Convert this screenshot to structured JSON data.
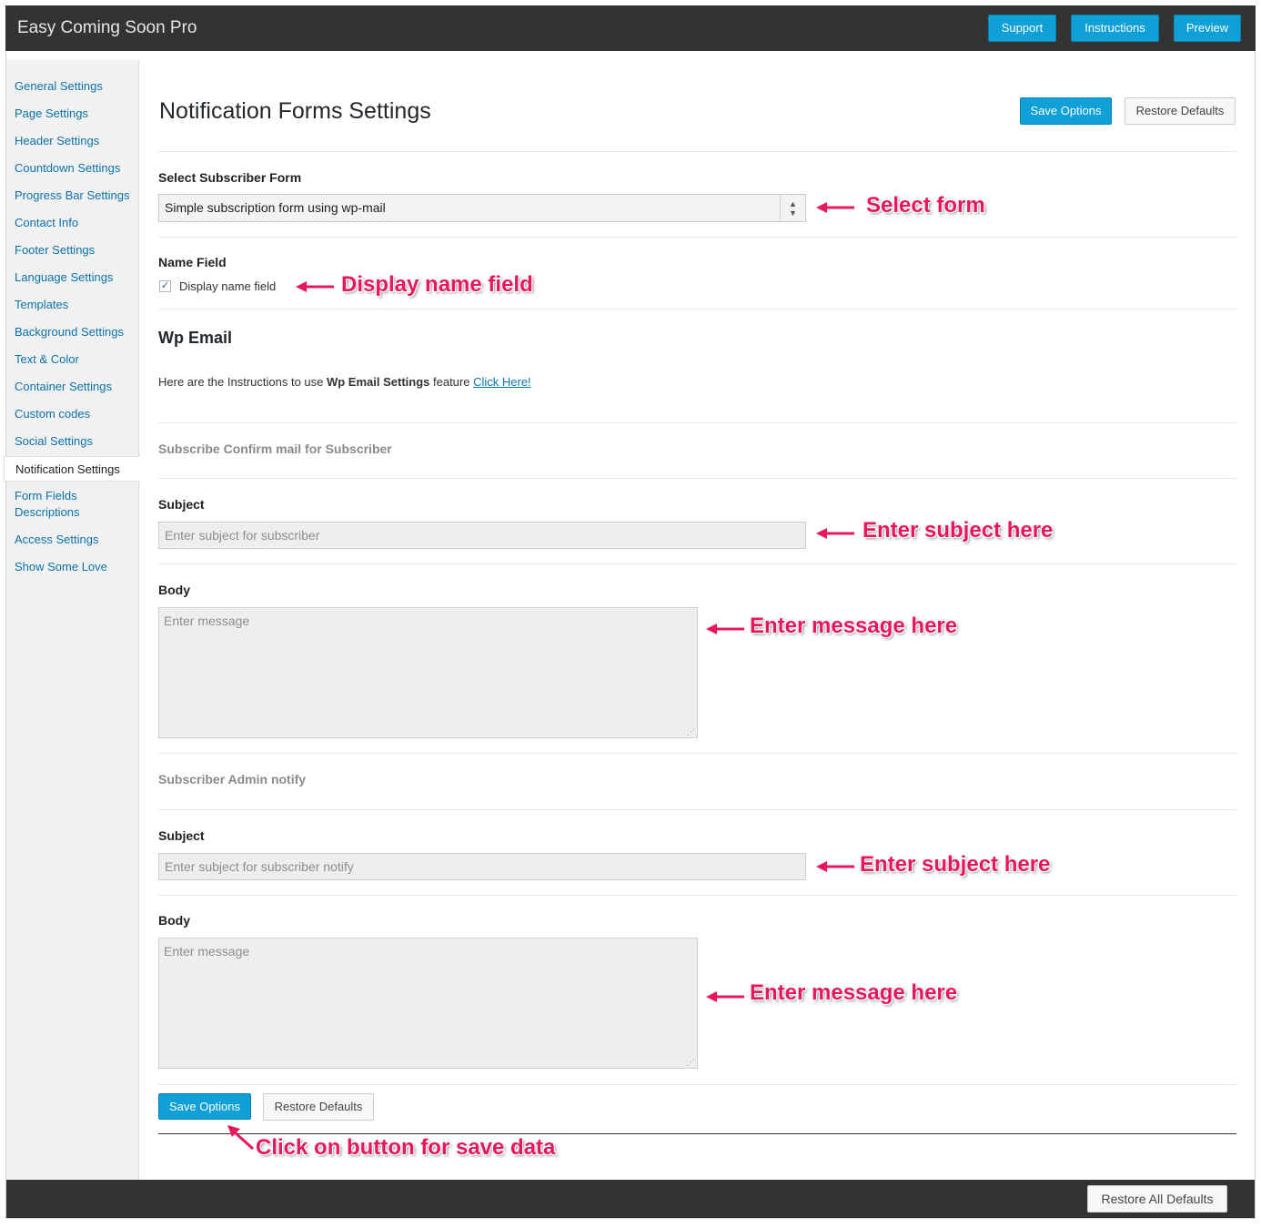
{
  "app": {
    "title": "Easy Coming Soon Pro",
    "top_buttons": {
      "support": "Support",
      "instructions": "Instructions",
      "preview": "Preview"
    }
  },
  "sidebar": {
    "items": [
      {
        "label": "General Settings"
      },
      {
        "label": "Page Settings"
      },
      {
        "label": "Header Settings"
      },
      {
        "label": "Countdown Settings"
      },
      {
        "label": "Progress Bar Settings"
      },
      {
        "label": "Contact Info"
      },
      {
        "label": "Footer Settings"
      },
      {
        "label": "Language Settings"
      },
      {
        "label": "Templates"
      },
      {
        "label": "Background Settings"
      },
      {
        "label": "Text & Color"
      },
      {
        "label": "Container Settings"
      },
      {
        "label": "Custom codes"
      },
      {
        "label": "Social Settings"
      },
      {
        "label": "Notification Settings",
        "active": true
      },
      {
        "label": "Form Fields Descriptions",
        "line1": "Form Fields",
        "line2": "Descriptions"
      },
      {
        "label": "Access Settings"
      },
      {
        "label": "Show Some Love"
      }
    ]
  },
  "main": {
    "title": "Notification Forms Settings",
    "save_label": "Save Options",
    "restore_label": "Restore Defaults",
    "subscriber_form": {
      "label": "Select Subscriber Form",
      "selected": "Simple subscription form using wp-mail"
    },
    "name_field": {
      "label": "Name Field",
      "checkbox_label": "Display name field",
      "checked": true
    },
    "wp_email": {
      "heading": "Wp Email",
      "instr_prefix": "Here are the Instructions to use ",
      "instr_bold": "Wp Email Settings",
      "instr_suffix": " feature ",
      "instr_link": "Click Here!"
    },
    "confirm_mail": {
      "heading": "Subscribe Confirm mail for Subscriber",
      "subject_label": "Subject",
      "subject_placeholder": "Enter subject for subscriber",
      "body_label": "Body",
      "body_placeholder": "Enter message"
    },
    "admin_notify": {
      "heading": "Subscriber Admin notify",
      "subject_label": "Subject",
      "subject_placeholder": "Enter subject for subscriber notify",
      "body_label": "Body",
      "body_placeholder": "Enter message"
    },
    "bottom_save_label": "Save Options",
    "bottom_restore_label": "Restore Defaults"
  },
  "annotations": {
    "select_form": "Select form",
    "display_name": "Display name field",
    "subject_1": "Enter subject here",
    "message_1": "Enter message here",
    "subject_2": "Enter subject here",
    "message_2": "Enter message here",
    "save": "Click on button for save data"
  },
  "footer": {
    "restore_all_label": "Restore All Defaults"
  },
  "colors": {
    "accent": "#0ea0d6",
    "annotation": "#e8175d",
    "topbar": "#333333"
  }
}
